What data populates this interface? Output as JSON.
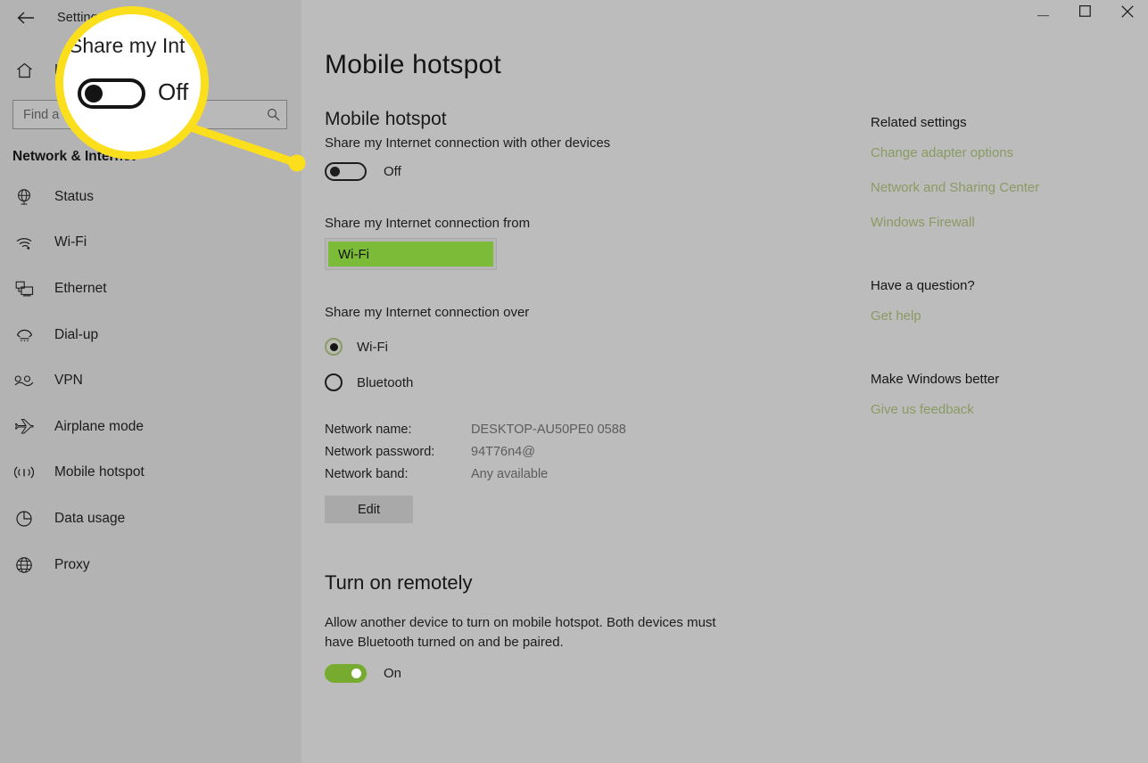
{
  "window": {
    "app_title": "Settings",
    "back_icon": "back-arrow-icon",
    "controls": {
      "minimize": "–",
      "maximize": "□",
      "close": "✕"
    }
  },
  "sidebar": {
    "home_label": "Home",
    "home_icon": "home-icon",
    "search": {
      "placeholder": "Find a setting",
      "value": "",
      "icon": "search-icon"
    },
    "category": "Network & Internet",
    "items": [
      {
        "label": "Status",
        "icon": "globe-status-icon"
      },
      {
        "label": "Wi-Fi",
        "icon": "wifi-icon"
      },
      {
        "label": "Ethernet",
        "icon": "ethernet-icon"
      },
      {
        "label": "Dial-up",
        "icon": "dialup-icon"
      },
      {
        "label": "VPN",
        "icon": "vpn-icon"
      },
      {
        "label": "Airplane mode",
        "icon": "airplane-icon"
      },
      {
        "label": "Mobile hotspot",
        "icon": "hotspot-icon"
      },
      {
        "label": "Data usage",
        "icon": "data-usage-icon"
      },
      {
        "label": "Proxy",
        "icon": "proxy-globe-icon"
      }
    ]
  },
  "main": {
    "page_title": "Mobile hotspot",
    "hotspot": {
      "heading": "Mobile hotspot",
      "description": "Share my Internet connection with other devices",
      "toggle_state": "Off"
    },
    "share_from": {
      "label": "Share my Internet connection from",
      "selected": "Wi-Fi",
      "highlight_color": "#7cbb38"
    },
    "share_over": {
      "label": "Share my Internet connection over",
      "options": [
        {
          "label": "Wi-Fi",
          "selected": true
        },
        {
          "label": "Bluetooth",
          "selected": false
        }
      ]
    },
    "details": [
      {
        "key": "Network name:",
        "value": "DESKTOP-AU50PE0 0588"
      },
      {
        "key": "Network password:",
        "value": "94T76n4@"
      },
      {
        "key": "Network band:",
        "value": "Any available"
      }
    ],
    "edit_button": "Edit",
    "remote": {
      "heading": "Turn on remotely",
      "description": "Allow another device to turn on mobile hotspot. Both devices must have Bluetooth turned on and be paired.",
      "toggle_state": "On"
    }
  },
  "right_panel": {
    "related_heading": "Related settings",
    "related_links": [
      "Change adapter options",
      "Network and Sharing Center",
      "Windows Firewall"
    ],
    "question_heading": "Have a question?",
    "question_links": [
      "Get help"
    ],
    "feedback_heading": "Make Windows better",
    "feedback_links": [
      "Give us feedback"
    ],
    "link_color": "#8a9a62"
  },
  "callout": {
    "magnified_text": "Share my Int",
    "magnified_toggle_state": "Off",
    "accent_color": "#fcdf1c"
  }
}
